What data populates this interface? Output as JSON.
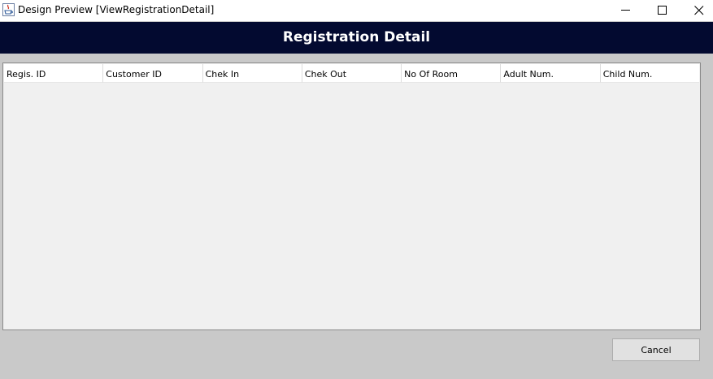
{
  "window": {
    "title": "Design Preview [ViewRegistrationDetail]",
    "icon": "java-coffee-cup-icon",
    "controls": [
      "minimize-icon",
      "maximize-icon",
      "close-icon"
    ]
  },
  "header": {
    "title": "Registration Detail",
    "background_color": "#030a30",
    "text_color": "#ffffff"
  },
  "table": {
    "columns": [
      "Regis. ID",
      "Customer ID",
      "Chek In",
      "Chek Out",
      "No Of Room",
      "Adult Num.",
      "Child Num."
    ],
    "rows": []
  },
  "footer": {
    "cancel_label": "Cancel"
  }
}
